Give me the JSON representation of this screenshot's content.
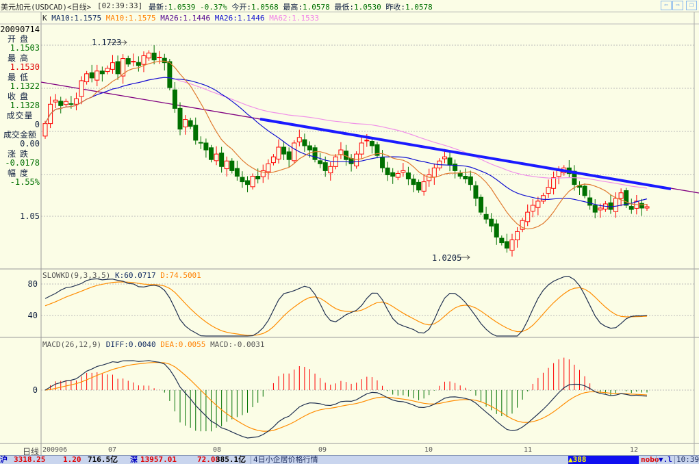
{
  "title": {
    "name": "美元加元(USDCAD)<日线>",
    "time": "[02:39:33]",
    "latest_label": "最新:",
    "latest": "1.0539",
    "change": "-0.37%",
    "open_label": "今开:",
    "open": "1.0568",
    "high_label": "最高:",
    "high": "1.0578",
    "low_label": "最低:",
    "low": "1.0530",
    "prev_label": "昨收:",
    "prev": "1.0578"
  },
  "buttons": {
    "back": "⇦",
    "forward": "⇨",
    "restore": "❐"
  },
  "ma_legend": {
    "k": "K",
    "ma10a": "MA10:1.1575",
    "ma10b": "MA10:1.1575",
    "ma26a": "MA26:1.1446",
    "ma26b": "MA26:1.1446",
    "ma62": "MA62:1.1533"
  },
  "info": {
    "date": "20090714",
    "open_label": "开盘",
    "open": "1.1503",
    "high_label": "最高",
    "high": "1.1530",
    "low_label": "最低",
    "low": "1.1322",
    "close_label": "收盘",
    "close": "1.1328",
    "vol_label": "成交量",
    "vol": "0",
    "amount_label": "成交金额",
    "amount": "0.00",
    "chg_label": "涨跌",
    "chg": "-0.0178",
    "pct_label": "幅度",
    "pct": "-1.55%"
  },
  "colors": {
    "up": "#ff0000",
    "down": "#007000",
    "ma10": "#e07a30",
    "ma26": "#1010d0",
    "ma62": "#f090e8",
    "trend": "#1a1aff",
    "trend2": "#800080",
    "k": "#203050",
    "d": "#ff8c00"
  },
  "annotations": {
    "high": "1.1723",
    "low": "1.0205"
  },
  "kd": {
    "title": "SLOWKD(9,3,3,5)",
    "k": "K:60.0717",
    "d": "D:74.5001",
    "tick_80": "80",
    "tick_40": "40"
  },
  "macd": {
    "title": "MACD(26,12,9)",
    "diff": "DIFF:0.0040",
    "dea": "DEA:0.0055",
    "macd": "MACD:-0.0031",
    "tick_0": "0"
  },
  "axis": {
    "period": "日线",
    "labels": [
      "200906",
      "07",
      "08",
      "09",
      "10",
      "11",
      "12"
    ],
    "price_tick": "1.05"
  },
  "status": {
    "sh_label": "沪",
    "sh": "3318.25",
    "sh_chg": "1.20",
    "sh_amt": "716.5亿",
    "sz_label": "深",
    "sz": "13957.01",
    "sz_chg": "72.08",
    "sz_amt": "385.1亿",
    "news": "4日小企居价格行情",
    "alert": "▲388",
    "nobo": "nobo",
    "signal": "▼.l",
    "clock": "10:39"
  },
  "chart_data": {
    "type": "candlestick",
    "ylim": [
      1.009,
      1.186
    ],
    "closes": [
      1.114,
      1.128,
      1.131,
      1.127,
      1.13,
      1.128,
      1.132,
      1.145,
      1.15,
      1.147,
      1.152,
      1.15,
      1.154,
      1.158,
      1.15,
      1.161,
      1.157,
      1.159,
      1.156,
      1.163,
      1.165,
      1.16,
      1.162,
      1.158,
      1.14,
      1.125,
      1.11,
      1.117,
      1.112,
      1.102,
      1.1,
      1.095,
      1.088,
      1.092,
      1.083,
      1.087,
      1.08,
      1.076,
      1.072,
      1.07,
      1.076,
      1.074,
      1.08,
      1.085,
      1.09,
      1.097,
      1.092,
      1.088,
      1.1,
      1.104,
      1.098,
      1.095,
      1.088,
      1.085,
      1.08,
      1.083,
      1.09,
      1.095,
      1.088,
      1.085,
      1.092,
      1.1,
      1.102,
      1.098,
      1.091,
      1.082,
      1.077,
      1.076,
      1.078,
      1.08,
      1.074,
      1.07,
      1.066,
      1.072,
      1.077,
      1.082,
      1.087,
      1.09,
      1.084,
      1.08,
      1.076,
      1.074,
      1.07,
      1.06,
      1.05,
      1.045,
      1.04,
      1.032,
      1.028,
      1.024,
      1.03,
      1.036,
      1.044,
      1.05,
      1.055,
      1.058,
      1.062,
      1.068,
      1.075,
      1.08,
      1.082,
      1.078,
      1.07,
      1.068,
      1.062,
      1.055,
      1.05,
      1.053,
      1.056,
      1.052,
      1.06,
      1.064,
      1.055,
      1.052,
      1.058,
      1.053,
      1.054
    ],
    "first_open": 1.105
  }
}
